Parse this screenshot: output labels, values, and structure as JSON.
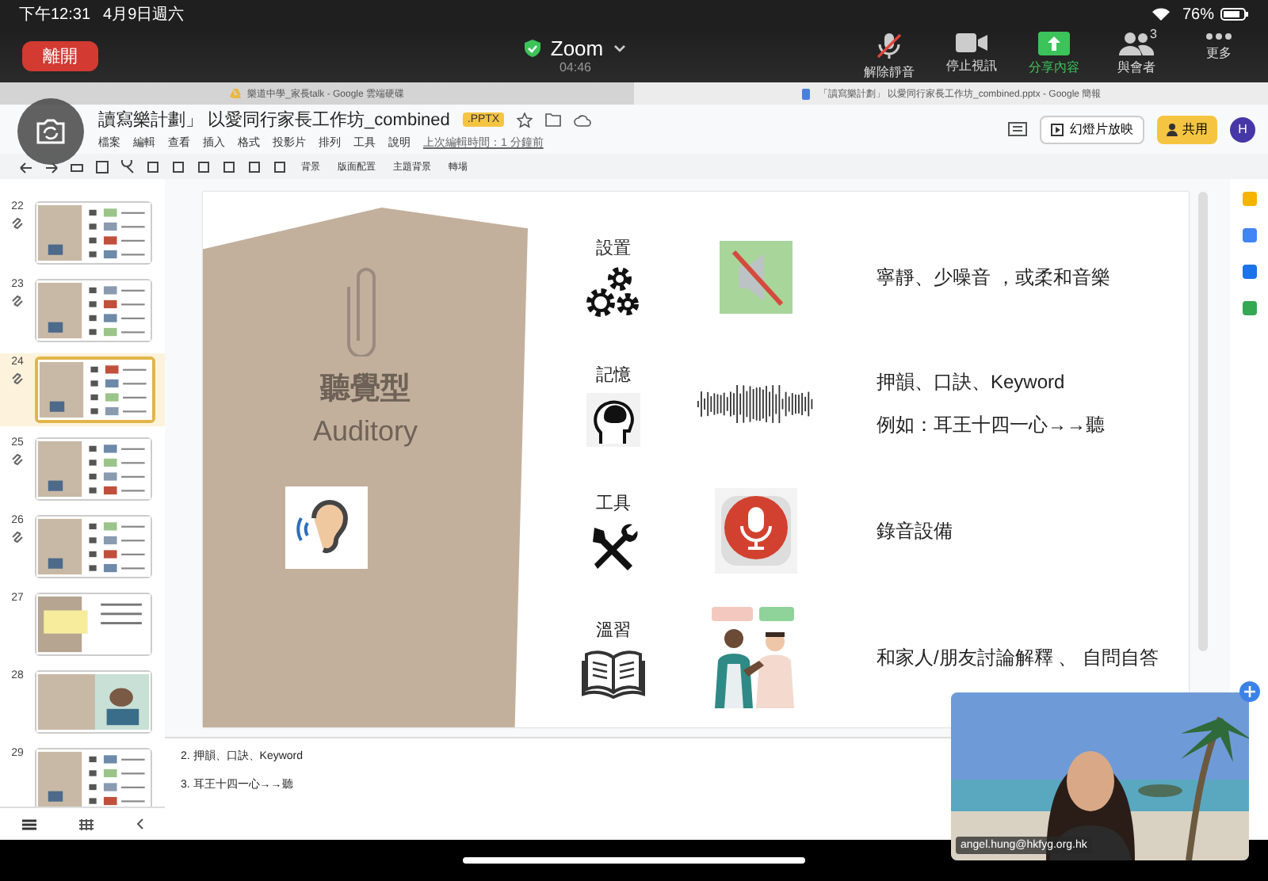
{
  "status_bar": {
    "time": "下午12:31",
    "date": "4月9日週六",
    "battery": "76%"
  },
  "zoom": {
    "leave": "離開",
    "title": "Zoom",
    "duration": "04:46",
    "controls": [
      {
        "kind": "mic-muted",
        "label": "解除靜音",
        "active": false
      },
      {
        "kind": "video",
        "label": "停止視訊",
        "active": false
      },
      {
        "kind": "share",
        "label": "分享內容",
        "active": true
      },
      {
        "kind": "participants",
        "label": "與會者",
        "count": "3",
        "active": false
      },
      {
        "kind": "more",
        "label": "更多",
        "active": false
      }
    ]
  },
  "browser_tabs": [
    {
      "title": "樂道中學_家長talk - Google 雲端硬碟",
      "selected": false
    },
    {
      "title": "「讀寫樂計劃」 以愛同行家長工作坊_combined.pptx - Google 簡報",
      "selected": true
    }
  ],
  "document": {
    "title": "讀寫樂計劃」 以愛同行家長工作坊_combined",
    "badge": ".PPTX",
    "menus": [
      "檔案",
      "編輯",
      "查看",
      "插入",
      "格式",
      "投影片",
      "排列",
      "工具",
      "說明"
    ],
    "last_edit": "上次編輯時間：1 分鐘前",
    "slideshow": "幻燈片放映",
    "share": "共用",
    "avatar": "H"
  },
  "toolbar": {
    "buttons": [
      "背景",
      "版面配置",
      "主題背景",
      "轉場"
    ]
  },
  "filmstrip": [
    {
      "number": "22",
      "linked": true,
      "selected": false
    },
    {
      "number": "23",
      "linked": true,
      "selected": false
    },
    {
      "number": "24",
      "linked": true,
      "selected": true
    },
    {
      "number": "25",
      "linked": true,
      "selected": false
    },
    {
      "number": "26",
      "linked": true,
      "selected": false
    },
    {
      "number": "27",
      "linked": false,
      "selected": false
    },
    {
      "number": "28",
      "linked": false,
      "selected": false
    },
    {
      "number": "29",
      "linked": false,
      "selected": false
    }
  ],
  "slide": {
    "panel_title": "聽覺型",
    "panel_subtitle": "Auditory",
    "rows": [
      {
        "kind": "settings",
        "label": "設置",
        "texts": [
          "寧靜、少噪音 ，或柔和音樂"
        ]
      },
      {
        "kind": "memory",
        "label": "記憶",
        "texts": [
          "押韻、口訣、Keyword",
          "例如：耳王十四一心→→聽"
        ]
      },
      {
        "kind": "tools",
        "label": "工具",
        "texts": [
          "錄音設備"
        ]
      },
      {
        "kind": "review",
        "label": "溫習",
        "texts": [
          "和家人/朋友討論解釋 、 自問自答"
        ]
      }
    ]
  },
  "notes": [
    "2. 押韻、口訣、Keyword",
    "3. 耳王十四一心→→聽"
  ],
  "video": {
    "name": "angel.hung@hkfyg.org.hk"
  }
}
